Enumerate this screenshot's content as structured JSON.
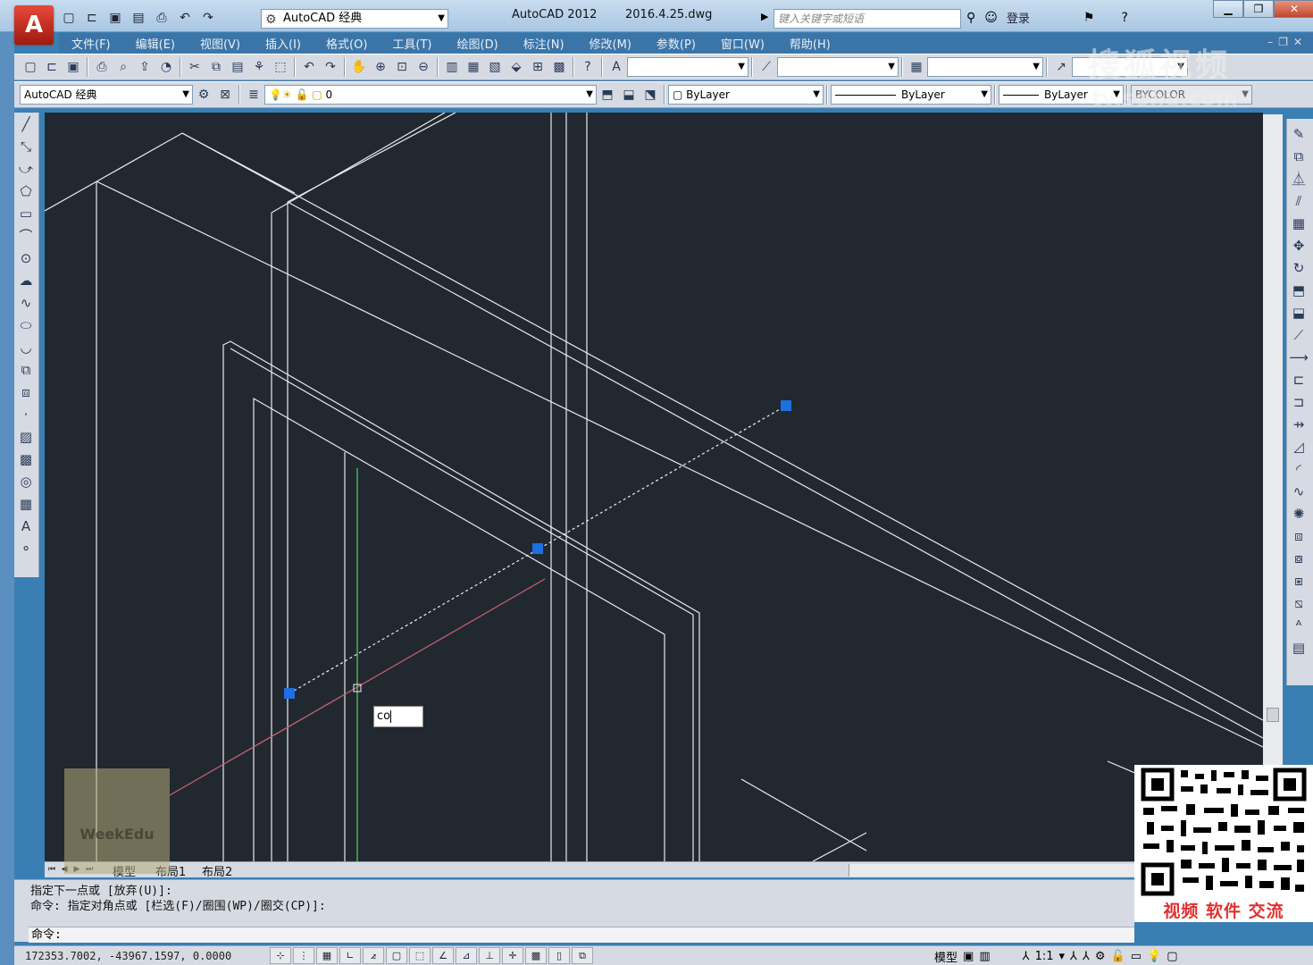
{
  "app": {
    "logo": "A",
    "title": "AutoCAD 2012",
    "file": "2016.4.25.dwg",
    "workspace": "AutoCAD 经典",
    "search_placeholder": "键入关键字或短语",
    "login": "登录"
  },
  "menu": [
    "文件(F)",
    "编辑(E)",
    "视图(V)",
    "插入(I)",
    "格式(O)",
    "工具(T)",
    "绘图(D)",
    "标注(N)",
    "修改(M)",
    "参数(P)",
    "窗口(W)",
    "帮助(H)"
  ],
  "properties": {
    "workspace": "AutoCAD 经典",
    "layer": "0",
    "color": "ByLayer",
    "linetype": "ByLayer",
    "lineweight": "ByLayer",
    "plotstyle": "BYCOLOR"
  },
  "canvas": {
    "command_input": "co"
  },
  "tabs": [
    "模型",
    "布局1",
    "布局2"
  ],
  "command_history": [
    "指定下一点或 [放弃(U)]:",
    "命令: 指定对角点或 [栏选(F)/圈围(WP)/圈交(CP)]:"
  ],
  "command_prompt": "命令:",
  "status": {
    "coords": "172353.7002, -43967.1597, 0.0000",
    "model_label": "模型",
    "scale": "1:1"
  },
  "overlays": {
    "qr_caption": "视频 软件 交流",
    "watermark": "WeekEdu",
    "sohu": "搜狐视频",
    "sohu_url": "tv.sohu.com"
  },
  "colors": {
    "canvas_bg": "#212830",
    "grip": "#1e6fe0",
    "menubar": "#3b75a8",
    "ortho_red": "#d06070",
    "ortho_green": "#5fcf6f"
  }
}
